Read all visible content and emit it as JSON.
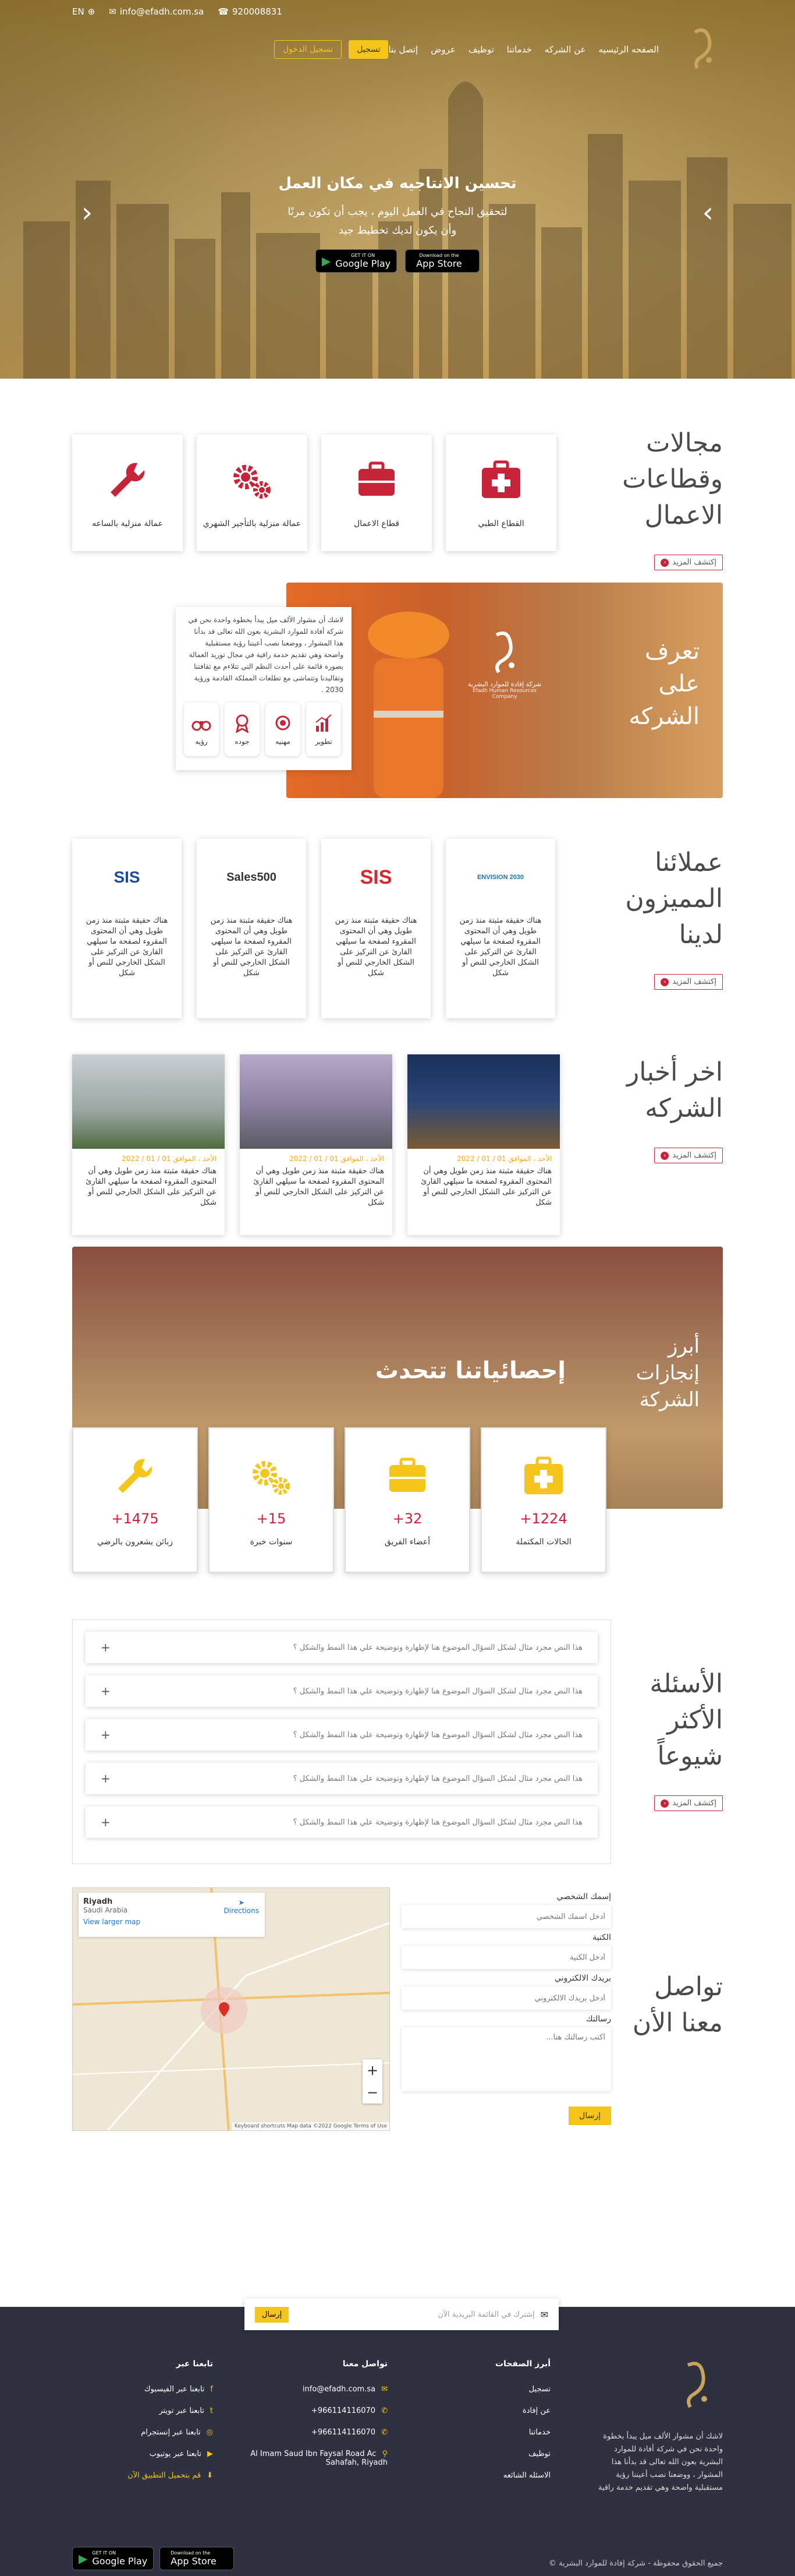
{
  "topbar": {
    "lang": "EN",
    "email": "info@efadh.com.sa",
    "phone": "920008831"
  },
  "nav": {
    "items": [
      "الصفحه الرئيسيه",
      "عن الشركه",
      "خدماتنا",
      "توظيف",
      "عروض",
      "إتصل بنا"
    ],
    "login": "تسجيل",
    "register": "تسجيل الدخول"
  },
  "hero": {
    "title": "تحسين الانتاجيه في مكان العمل",
    "text": "لتحقيق النجاح في العمل اليوم ، يجب أن تكون مرنًا وأن يكون لديك تخطيط جيد",
    "google_small": "GET IT ON",
    "google_big": "Google Play",
    "apple_small": "Download on the",
    "apple_big": "App Store"
  },
  "sectors": {
    "title": "مجالات وقطاعات الاعمال",
    "more": "إكتشف المزيد",
    "cards": [
      "عمالة منزلية بالساعه",
      "عمالة منزلية بالتأجير الشهري",
      "قطاع الاعمال",
      "القطاع الطبي"
    ]
  },
  "about": {
    "title": "تعرف على الشركه",
    "logo_ar": "شركة إفادة للموارد البشرية",
    "logo_en": "Efadh Human Resources Company",
    "text": "لاشك أن مشوار الألف ميل يبدأ بخطوة واحدة نحن في شركة أفادة للموارد البشرية بعون الله تعالى قد بدأنا هذا المشوار ، ووضعنا نصب أعيننا رؤية مستقبلية واضحة وهي تقديم خدمة راقية في مجال توريد العمالة بصورة قائمة على أحدث النظم التي تتلاءم مع ثقافتنا وتقاليدنا وتتماشى مع تطلعات المملكة القادمة ورؤية 2030 .",
    "features": [
      "رؤيه",
      "جوده",
      "مهنيه",
      "تطوير"
    ]
  },
  "clients": {
    "title": "عملائنا المميزون لدينا",
    "more": "إكتشف المزيد",
    "logos": [
      "SIS",
      "Sales500",
      "SIS",
      "ENVISION 2030"
    ],
    "text": "هناك حقيقة مثبتة منذ زمن طويل وهي أن المحتوى المقروء لصفحة ما سيلهي القارئ عن التركيز على الشكل الخارجي للنص أو شكل"
  },
  "news": {
    "title": "اخر أخبار الشركه",
    "more": "إكتشف المزيد",
    "dates": [
      "الأحد ، الموافق 01 / 01 / 2022",
      "الأحد ، الموافق 01 / 01 / 2022",
      "الأحد ، الموافق 01 / 01 / 2022"
    ],
    "text": "هناك حقيقة مثبتة منذ زمن طويل وهي أن المحتوى المقروء لصفحة ما سيلهي القارئ عن التركيز على الشكل الخارجي للنص أو شكل"
  },
  "stats": {
    "side_title": "أبرز إنجازات الشركة",
    "main_title": "إحصائياتنا تتحدث",
    "cards": [
      {
        "num": "1475+",
        "label": "زبائن يشعرون بالرضي"
      },
      {
        "num": "15+",
        "label": "سنوات خبرة"
      },
      {
        "num": "32+",
        "label": "أعضاء الفريق"
      },
      {
        "num": "1224+",
        "label": "الحالات المكتملة"
      }
    ]
  },
  "faq": {
    "title": "الأسئلة الأكثر شيوعاً",
    "more": "إكتشف المزيد",
    "items": [
      "هذا النص مجرد مثال لشكل السؤال الموضوع هنا لإظهارة وتوضيحة علي هذا النمط والشكل ؟",
      "هذا النص مجرد مثال لشكل السؤال الموضوع هنا لإظهارة وتوضيحة علي هذا النمط والشكل ؟",
      "هذا النص مجرد مثال لشكل السؤال الموضوع هنا لإظهارة وتوضيحة علي هذا النمط والشكل ؟",
      "هذا النص مجرد مثال لشكل السؤال الموضوع هنا لإظهارة وتوضيحة علي هذا النمط والشكل ؟",
      "هذا النص مجرد مثال لشكل السؤال الموضوع هنا لإظهارة وتوضيحة علي هذا النمط والشكل ؟"
    ]
  },
  "contact": {
    "title": "تواصل معنا الأن",
    "name_label": "إسمك الشخصي",
    "name_ph": "أدخل اسمك الشخصي",
    "company_label": "الكنية",
    "company_ph": "أدخل الكنية",
    "email_label": "بريدك الالكتروني",
    "email_ph": "أدخل بريدك الالكتروني",
    "msg_label": "رسالتك",
    "msg_ph": "اكتب رسالتك هنا...",
    "send": "إرسال"
  },
  "map": {
    "place": "Riyadh",
    "region": "Saudi Arabia",
    "link": "View larger map",
    "directions": "Directions",
    "footer": "Keyboard shortcuts   Map data ©2022 Google   Terms of Use"
  },
  "footer": {
    "subscribe_ph": "إشترك في القائمة البريدية الآن",
    "subscribe_btn": "إرسال",
    "links_title": "أبرز الصفحات",
    "links": [
      "تسجيل",
      "عن إفادة",
      "خدماتنا",
      "توظيف",
      "الاسئله الشائعه"
    ],
    "contact_title": "تواصل معنا",
    "email": "info@efadh.com.sa",
    "phone1": "966114116070+",
    "phone2": "966114116070+",
    "address": "Al Imam Saud Ibn Faysal Road Ac Sahafah, Riyadh",
    "follow_title": "تابعنا عبر",
    "follow": [
      "تابعنا عبر الفيسبوك",
      "تابعنا عبر تويتر",
      "تابعنا عبر إنستجرام",
      "تابعنا عبر يوتيوب"
    ],
    "download": "قم بتحميل التطبيق الآن",
    "about": "لاشك أن مشوار الألف ميل يبدأ بخطوة واحدة نحن في شركة أفادة للموارد البشرية بعون الله تعالى قد بدأنا هذا المشوار ، ووضعنا نصب أعيننا رؤية مستقبلية واضحة وهي تقديم خدمة راقية",
    "copyright": "جميع الحقوق محفوظة - شركة إفادة للموارد البشرية ©"
  },
  "colors": {
    "accent": "#f5c51c",
    "brand_red": "#c7243a",
    "footer_bg": "#2f3140"
  }
}
